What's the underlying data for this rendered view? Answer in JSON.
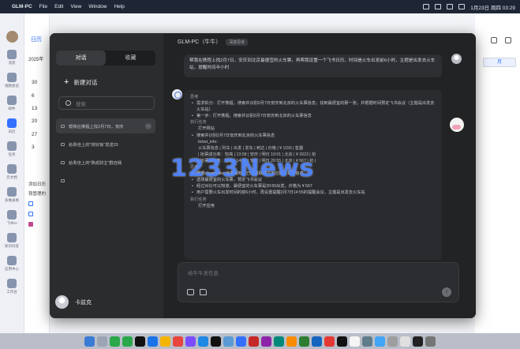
{
  "menubar": {
    "app_name": "GLM-PC",
    "menus": [
      "File",
      "Edit",
      "View",
      "Window",
      "Help"
    ],
    "datetime": "1月23日 周四 03:29"
  },
  "background_app": {
    "tab_title": "日历",
    "year_label": "2025年",
    "date_numbers": [
      "30",
      "6",
      "13",
      "20",
      "27",
      "3"
    ],
    "rail_labels": [
      "消息",
      "视频会议",
      "邮件",
      "日历",
      "任务",
      "云文档",
      "多维表格",
      "飞书AI",
      "知识问答",
      "应用中心",
      "工作台"
    ],
    "list_labels": [
      "添加日历",
      "我管理的"
    ],
    "month_button": "月"
  },
  "chat": {
    "tabs": [
      {
        "label": "对话",
        "active": true
      },
      {
        "label": "收藏",
        "active": false
      }
    ],
    "new_chat_label": "新建对话",
    "search_placeholder": "搜索",
    "history": [
      {
        "label": "帮我在携程上找2月7日，安庆",
        "active": true
      },
      {
        "label": "给青佳上的\"拼好饭\"发送20",
        "active": false
      },
      {
        "label": "给青佳上的\"熟成财主\"群自我",
        "active": false
      },
      {
        "label": "",
        "active": false
      }
    ],
    "user_name": "卡兹克",
    "title": "GLM-PC（牛牛）",
    "title_badge": "深度思考",
    "user_message": "帮我在携程上找2月7日，安庆到北京最便宜的火车票，再帮我设置一个飞书日历，时间是火车出发前6小时，主题是出发去火车站，提醒时间半小时",
    "reply": {
      "section_think": "思考",
      "think_items": [
        "需求拆分：打开携程，搜索并识别2月7日安庆到北京的火车票信息；找到最便宜的那一张，并根据时间预定飞书会议（主题是出发去火车站）",
        "第一步：打开携程，搜索并识别2月7日安庆到北京的火车票信息"
      ],
      "section_task1": "执行任务",
      "task1_title": "打开网站",
      "task1_items": [
        "搜索并识别2月7日安庆到北京的火车票信息"
      ],
      "ticket_label": "ticket_info:",
      "ticket_rows": [
        "火车票信息 | 列车 | 出发 | 发车 | 到达 | 价格 | ¥ 1150 | 售罄",
        "| 抢票成功率：较高 | 13:58 | 安庆 | 明日 10:01 | 北京 | ¥ 2023 | 抢",
        "| 抢票成功率：较高 | 14:47 | 安庆 | 明日 20:55 | 北京 | ¥ 567 | 抢 |"
      ],
      "section_think2": "思考",
      "think2_items": [
        "根据observation信息得知，已经获取到了对应的火车票信息",
        "选择最便宜的火车票，预定飞书会议",
        "经过对比可以知道，最便宜的火车票是20:55出发，价格为 ¥ 567",
        "用户需要火车出发时间的前6小时，再设置提醒2月7日14:55的提醒会议，主题是出发去火车站"
      ],
      "section_task2": "执行任务",
      "task2_title": "打开应用"
    },
    "input_placeholder": "给牛牛发信息",
    "send_icon": "arrow-up-icon"
  },
  "watermark_text": "1233News"
}
